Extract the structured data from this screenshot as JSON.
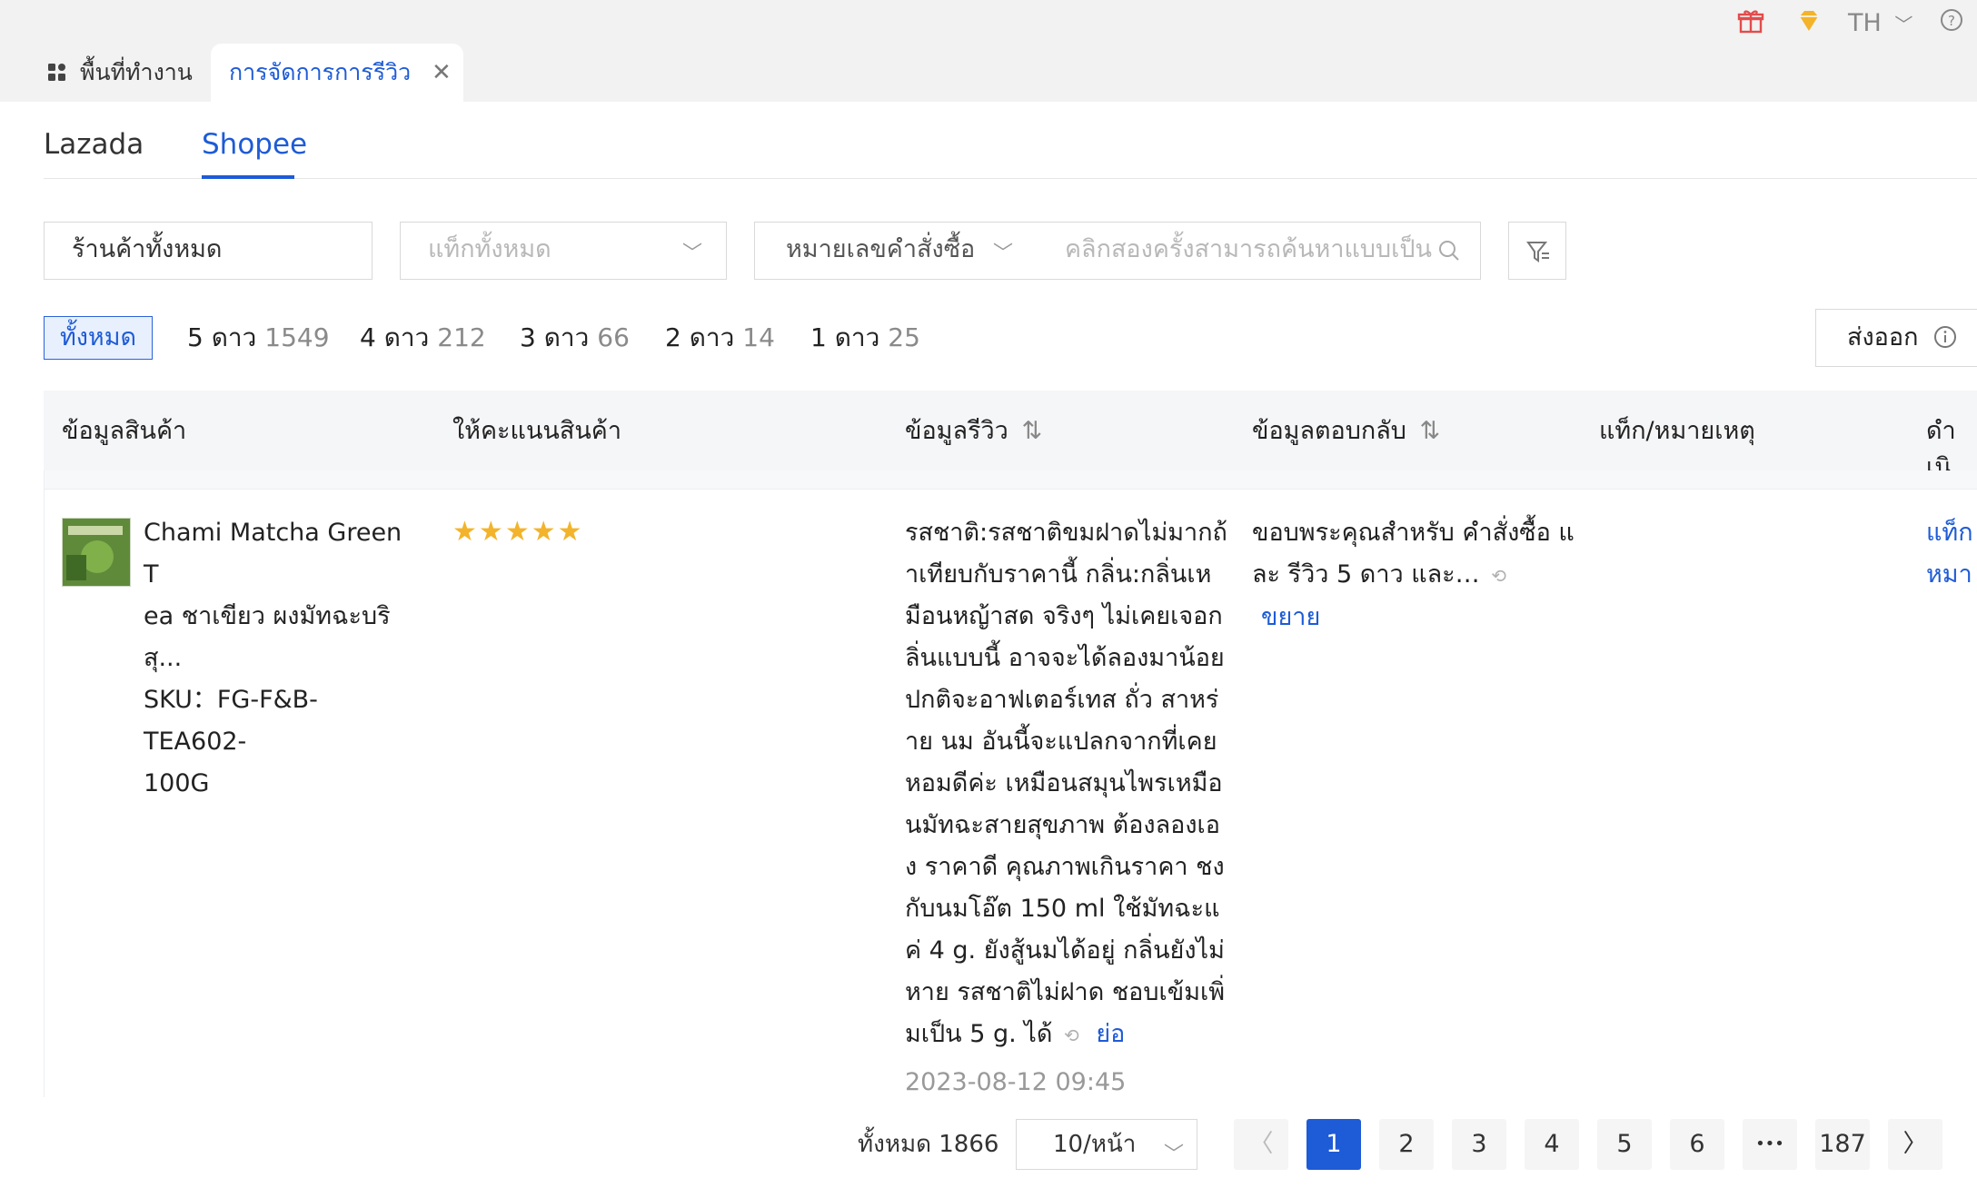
{
  "header": {
    "gift_icon": "gift-icon",
    "vip_icon": "diamond-icon",
    "language": "TH",
    "help_icon": "help-icon"
  },
  "tabs": {
    "workspace_label": "พื้นที่ทำงาน",
    "active_label": "การจัดการการรีวิว",
    "close_icon": "close-icon"
  },
  "platforms": [
    "Lazada",
    "Shopee"
  ],
  "filters": {
    "store": "ร้านค้าทั้งหมด",
    "tags_placeholder": "แท็กทั้งหมด",
    "search_type": "หมายเลขคำสั่งซื้อ",
    "search_placeholder": "คลิกสองครั้งสามารถค้นหาแบบเป็น"
  },
  "star_filter": {
    "all": "ทั้งหมด",
    "items": [
      {
        "label": "5 ดาว",
        "count": "1549"
      },
      {
        "label": "4 ดาว",
        "count": "212"
      },
      {
        "label": "3 ดาว",
        "count": "66"
      },
      {
        "label": "2 ดาว",
        "count": "14"
      },
      {
        "label": "1 ดาว",
        "count": "25"
      }
    ],
    "export": "ส่งออก"
  },
  "table": {
    "headers": {
      "product": "ข้อมูลสินค้า",
      "rating": "ให้คะแนนสินค้า",
      "review": "ข้อมูลรีวิว",
      "reply": "ข้อมูลตอบกลับ",
      "tags": "แท็ก/หมายเหตุ",
      "action": "ดำเนิ"
    },
    "row": {
      "product_name_1": "Chami Matcha Green T",
      "product_name_2": "ea ชาเขียว ผงมัทฉะบริสุ...",
      "sku_1": "SKU：FG-F&B-TEA602-",
      "sku_2": "100G",
      "rating": 5,
      "review_lines": [
        "รสชาติ:รสชาติขมฝาดไม่มากถ้",
        "าเทียบกับราคานี้ กลิ่น:กลิ่นเห",
        "มือนหญ้าสด จริงๆ ไม่เคยเจอก",
        "ลิ่นแบบนี้ อาจจะได้ลองมาน้อย",
        "ปกติจะอาฟเตอร์เทส ถั่ว สาหร่",
        "าย นม อันนี้จะแปลกจากที่เคย",
        "หอมดีค่ะ เหมือนสมุนไพรเหมือ",
        "นมัทฉะสายสุขภาพ ต้องลองเอ",
        "ง ราคาดี คุณภาพเกินราคา ชง",
        "กับนมโอ๊ต 150 ml ใช้มัทฉะแ",
        "ค่ 4 g. ยังสู้นมได้อยู่ กลิ่นยังไม่",
        "หาย รสชาติไม่ฝาด ชอบเข้มเพิ่",
        "มเป็น 5 g. ได้"
      ],
      "collapse": "ย่อ",
      "review_date": "2023-08-12 09:45",
      "reply_line1": "ขอบพระคุณสำหรับ คำสั่งซื้อ แ",
      "reply_line2": "ละ รีวิว 5 ดาว และ…",
      "expand": "ขยาย",
      "action_1": "แท็ก",
      "action_2": "หมา"
    }
  },
  "pagination": {
    "total": "ทั้งหมด 1866",
    "page_size": "10/หน้า",
    "pages": [
      "1",
      "2",
      "3",
      "4",
      "5",
      "6"
    ],
    "ellipsis": "•••",
    "last": "187",
    "current": "1"
  }
}
